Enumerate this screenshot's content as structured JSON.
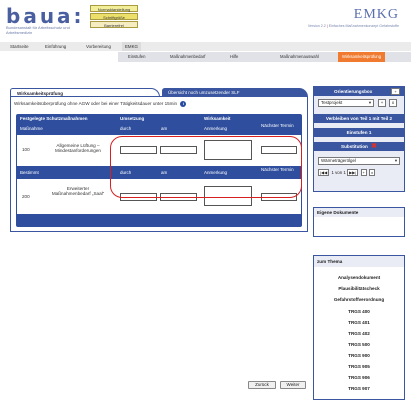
{
  "header": {
    "logo": "baua:",
    "logo_subtitle": "Bundesanstalt für Arbeitsschutz und Arbeitsmedizin",
    "buttons": [
      "Normaldarstellung",
      "Schriftgröße",
      "Barrierefrei"
    ],
    "brand": "EMKG",
    "brand_subtitle_left": "Version 2.2",
    "brand_subtitle_sep": "|",
    "brand_subtitle_right": "Einfaches Maßnahmenkonzept Gefahrstoffe"
  },
  "nav_primary": [
    "Startseite",
    "Einführung",
    "Vorbereitung",
    "EMKG"
  ],
  "nav_secondary": [
    "Einstufen",
    "Maßnahmenbedarf",
    "Hilfe",
    "Maßnahmenauswahl",
    "Wirksamkeitsprüfung"
  ],
  "main": {
    "tab_active": "Wirksamkeitsprüfung",
    "tab_inactive": "Übersicht noch umzusetzender SLF",
    "description": "Wirksamkeitsüberprüfung ohne AGW oder bei einer Tätigkeitsdauer unter 15min",
    "table": {
      "header_measures": "Festgelegte Schutzmaßnahmen",
      "header_implementation": "Umsetzung",
      "header_effectiveness": "Wirksamkeit",
      "subheader_measure": "Maßnahme",
      "subheader_by": "durch",
      "subheader_on": "am",
      "subheader_remark": "Anmerkung",
      "subheader_next": "Nächster Termin",
      "row1_code": "100",
      "row1_text": "Allgemeine Lüftung – Mindestanforderungen",
      "subheader_need": "Bestimmt",
      "row2_code": "200",
      "row2_text": "Erweiterter Maßnahmenbedarf „Saal“"
    },
    "back_button": "Zurück",
    "next_button": "Weiter"
  },
  "sidebar": {
    "orientation_title": "Orientierungsbox",
    "orientation_toggle": "+",
    "project_select": "Testprojekt",
    "project_btn1": "+",
    "project_btn2": "x",
    "part_label": "Verbleiben von Teil 1 mit Teil 2",
    "step_label": "Einstufen 1",
    "substitution_label": "Substitution",
    "substitution_mark": "✖",
    "material_select": "Wärmeträgerölgel",
    "pager_first": "|◀◀",
    "pager_text": "1 von 1",
    "pager_last": "▶▶|",
    "pager_plus": "+",
    "pager_x": "x",
    "own_docs_title": "Eigene Dokumente",
    "topic_title": "zum Thema",
    "topics": [
      "Analysendokument",
      "Plausibilitätscheck",
      "Gefahrstoffverordnung",
      "TRGS 400",
      "TRGS 401",
      "TRGS 402",
      "TRGS 500",
      "TRGS 900",
      "TRGS 905",
      "TRGS 906",
      "TRGS 907"
    ]
  },
  "colors": {
    "accent_blue": "#3a56a0",
    "nav_active_orange": "#f07a2f",
    "highlight_red": "#d62020"
  }
}
